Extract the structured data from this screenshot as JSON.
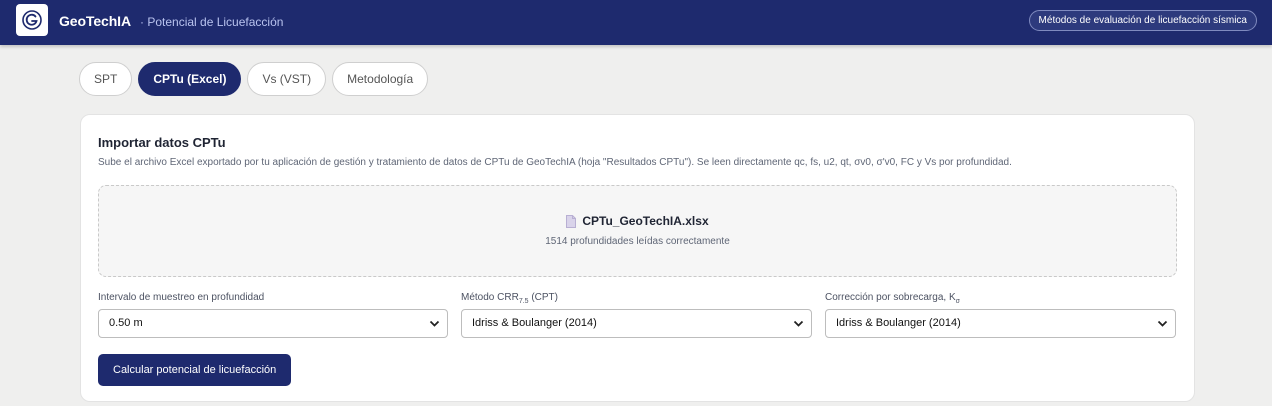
{
  "header": {
    "brand": "GeoTechIA",
    "subtitle": "· Potencial de Licuefacción",
    "methods_button": "Métodos de evaluación de licuefacción sísmica",
    "accent_color": "#1e2a6e"
  },
  "tabs": [
    {
      "label": "SPT",
      "active": false
    },
    {
      "label": "CPTu (Excel)",
      "active": true
    },
    {
      "label": "Vs (VST)",
      "active": false
    },
    {
      "label": "Metodología",
      "active": false
    }
  ],
  "card": {
    "title": "Importar datos CPTu",
    "description": "Sube el archivo Excel exportado por tu aplicación de gestión y tratamiento de datos de CPTu de GeoTechIA (hoja \"Resultados CPTu\"). Se leen directamente qc, fs, u2, qt, σv0, σ'v0, FC y Vs por profundidad.",
    "file_icon": "file-icon",
    "file_name": "CPTu_GeoTechIA.xlsx",
    "file_status": "1514 profundidades leídas correctamente",
    "fields": {
      "interval": {
        "label": "Intervalo de muestreo en profundidad",
        "value": "0.50 m"
      },
      "crr_method": {
        "label_prefix": "Método CRR",
        "label_sub": "7.5",
        "label_suffix": " (CPT)",
        "value": "Idriss & Boulanger (2014)"
      },
      "k_sigma": {
        "label_prefix": "Corrección por sobrecarga, K",
        "label_sub": "σ",
        "value": "Idriss & Boulanger (2014)"
      }
    },
    "calculate_button": "Calcular potencial de licuefacción"
  }
}
